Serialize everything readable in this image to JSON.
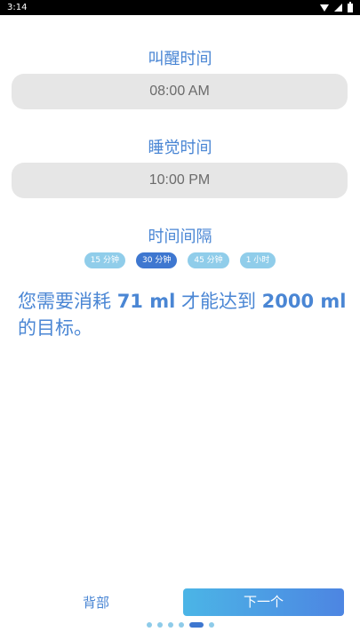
{
  "status_bar": {
    "time": "3:14"
  },
  "wake": {
    "title": "叫醒时间",
    "value": "08:00 AM"
  },
  "sleep": {
    "title": "睡觉时间",
    "value": "10:00 PM"
  },
  "interval": {
    "title": "时间间隔",
    "options": [
      "15 分钟",
      "30 分钟",
      "45 分钟",
      "1 小时"
    ],
    "selected": "30 分钟"
  },
  "goal": {
    "prefix": "您需要消耗 ",
    "amount": "71 ml",
    "middle": " 才能达到 ",
    "target": "2000 ml",
    "suffix": " 的目标。"
  },
  "footer": {
    "back_label": "背部",
    "next_label": "下一个"
  },
  "pager": {
    "count": 6,
    "current": 5
  },
  "colors": {
    "accent": "#4a86d4",
    "chip": "#90cdea",
    "chip_active": "#3e77d0"
  }
}
